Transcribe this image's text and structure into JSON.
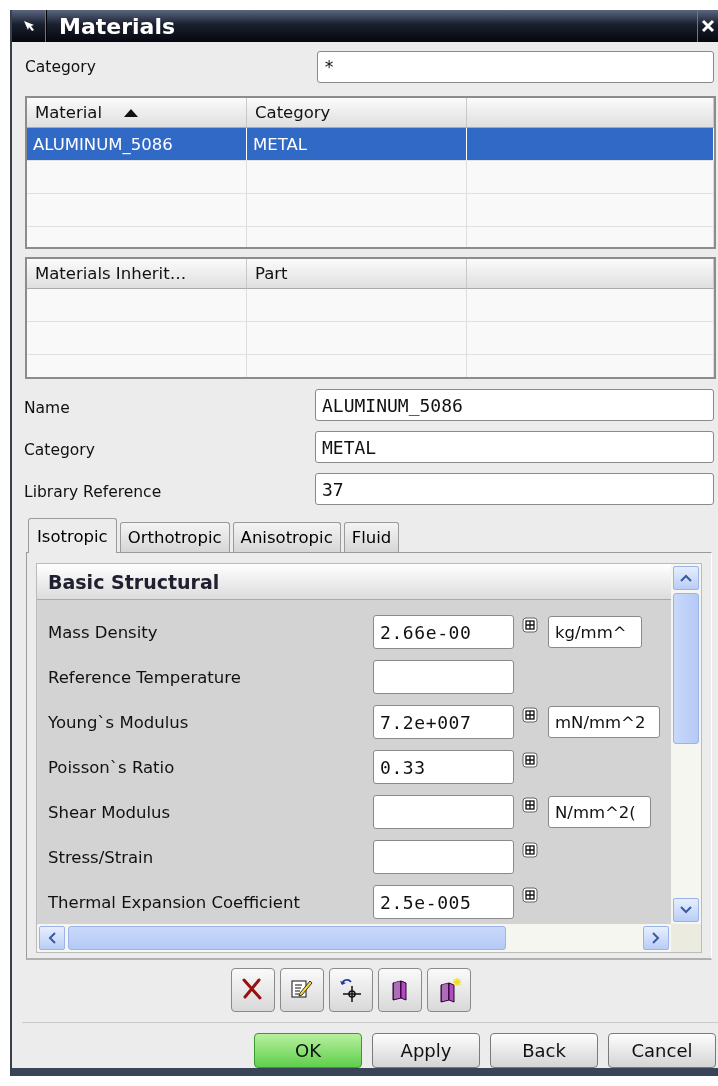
{
  "window": {
    "title": "Materials"
  },
  "filter": {
    "label": "Category",
    "value": "*"
  },
  "materials_table": {
    "columns": [
      {
        "label": "Material",
        "sort_ascending": true
      },
      {
        "label": "Category"
      }
    ],
    "rows": [
      {
        "cells": [
          "ALUMINUM_5086",
          "METAL"
        ],
        "selected": true
      }
    ]
  },
  "inheritance_table": {
    "columns": [
      {
        "label": "Materials Inherit…"
      },
      {
        "label": "Part"
      }
    ]
  },
  "fields": [
    {
      "label": "Name",
      "value": "ALUMINUM_5086"
    },
    {
      "label": "Category",
      "value": "METAL"
    },
    {
      "label": "Library Reference",
      "value": "37"
    }
  ],
  "tabs": [
    {
      "label": "Isotropic",
      "selected": true
    },
    {
      "label": "Orthotropic",
      "selected": false
    },
    {
      "label": "Anisotropic",
      "selected": false
    },
    {
      "label": "Fluid",
      "selected": false
    }
  ],
  "section": {
    "title": "Basic Structural",
    "properties": [
      {
        "label": "Mass Density",
        "value": "2.66e-00",
        "expression_button": true,
        "unit": "kg/mm^"
      },
      {
        "label": "Reference Temperature",
        "expression_button": false
      },
      {
        "label": "Young`s Modulus",
        "value": "7.2e+007",
        "expression_button": true,
        "unit": "mN/mm^2"
      },
      {
        "label": "Poisson`s Ratio",
        "value": "0.33",
        "expression_button": true
      },
      {
        "label": "Shear Modulus",
        "expression_button": true,
        "unit": "N/mm^2("
      },
      {
        "label": "Stress/Strain",
        "expression_button": true
      },
      {
        "label": "Thermal Expansion Coefficient",
        "value": "2.5e-005",
        "expression_button": true
      }
    ]
  },
  "toolbar": [
    {
      "kind": "delete"
    },
    {
      "kind": "edit"
    },
    {
      "kind": "inherit"
    },
    {
      "kind": "library"
    },
    {
      "kind": "new_library"
    }
  ],
  "buttons": [
    {
      "label": "OK",
      "default": true
    },
    {
      "label": "Apply",
      "default": false
    },
    {
      "label": "Back",
      "default": false
    },
    {
      "label": "Cancel",
      "default": false
    }
  ]
}
